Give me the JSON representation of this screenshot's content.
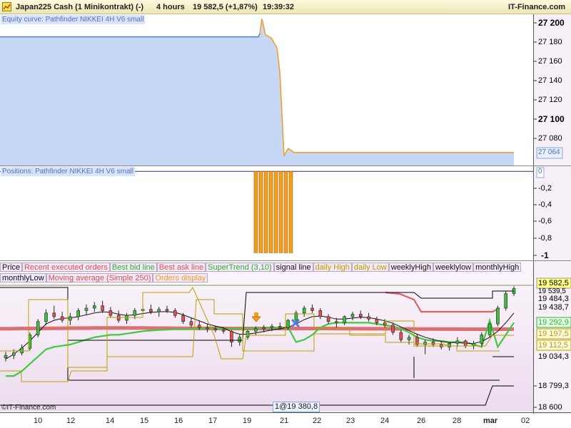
{
  "app": {
    "instrument": "Japan225 Cash (1 Minikontrakt) (-)",
    "timeframe": "4 hours",
    "last_price": "19 582,5 (+1,87%)",
    "time": "19:39:32",
    "brand": "IT-Finance.com",
    "copyright": "©IT-Finance.com"
  },
  "equity_pane": {
    "title": "Equity curve: Pathfinder NIKKEI 4H V6 small",
    "axis_labels": [
      "27 200",
      "27 180",
      "27 160",
      "27 140",
      "27 120",
      "27 100",
      "27 080"
    ],
    "current_label": "27 064",
    "chart_data": {
      "type": "area",
      "title": "Equity curve: Pathfinder NIKKEI 4H V6 small",
      "ylim": [
        27054,
        27205
      ],
      "y": [
        27183,
        27183,
        27183,
        27183,
        27183,
        27183,
        27183,
        27183,
        27183,
        27183,
        27183,
        27186,
        27201,
        27185,
        27182,
        27172,
        27148,
        27064,
        27071,
        27067,
        27067,
        27067,
        27067,
        27067,
        27067,
        27067,
        27067,
        27067,
        27067,
        27067,
        27067,
        27067,
        27067,
        27067,
        27067,
        27067,
        27067,
        27067,
        27067,
        27067
      ]
    }
  },
  "positions_pane": {
    "title": "Positions: Pathfinder NIKKEI 4H V6 small",
    "axis_labels": [
      "0",
      "-0,2",
      "-0,4",
      "-0,6",
      "-0,8",
      "-1"
    ],
    "chart_data": {
      "type": "bar",
      "title": "Positions: Pathfinder NIKKEI 4H V6 small",
      "ylim": [
        -1.05,
        0.02
      ],
      "values": [
        -1,
        -1,
        -1,
        -1,
        -1,
        -1,
        -1,
        -1
      ]
    }
  },
  "price_pane": {
    "legend_row1": [
      "Price",
      "Recent executed orders",
      "Best bid line",
      "Best ask line",
      "SuperTrend (3,10)",
      "signal line",
      "daily High",
      "daily Low",
      "weeklyHigh",
      "weeklylow",
      "monthlyHigh"
    ],
    "legend_row2": [
      "monthlyLow",
      "Moving average (Simple 250)",
      "Orders display"
    ],
    "legend_colors": [
      "#111111",
      "#e05050",
      "#30b030",
      "#e05050",
      "#30b030",
      "#111111",
      "#b8a000",
      "#b8a000",
      "#111111",
      "#111111",
      "#111111",
      "#111111",
      "#d85050",
      "#f0a020"
    ],
    "axis_labels": [
      "19 582,5",
      "19 539,5",
      "19 484,3",
      "19 438,7",
      "19 292,9",
      "19 197,5",
      "19 112,5",
      "19 034,3",
      "18 799,3",
      "18 600"
    ],
    "order_label": "1@19 380,8",
    "x_labels": [
      "10",
      "12",
      "14",
      "15",
      "16",
      "17",
      "19",
      "21",
      "22",
      "23",
      "24",
      "26",
      "28",
      "mar",
      "02"
    ],
    "chart_data": {
      "type": "candlestick",
      "ylim": [
        18590,
        19620
      ],
      "candles": [
        [
          19010,
          19060,
          18980,
          19030
        ],
        [
          19030,
          19080,
          19000,
          19050
        ],
        [
          19050,
          19120,
          19030,
          19090
        ],
        [
          19090,
          19220,
          19070,
          19200
        ],
        [
          19200,
          19330,
          19180,
          19310
        ],
        [
          19310,
          19410,
          19280,
          19380
        ],
        [
          19380,
          19440,
          19330,
          19350
        ],
        [
          19350,
          19390,
          19300,
          19320
        ],
        [
          19320,
          19380,
          19280,
          19350
        ],
        [
          19350,
          19420,
          19320,
          19400
        ],
        [
          19400,
          19450,
          19360,
          19420
        ],
        [
          19420,
          19470,
          19390,
          19440
        ],
        [
          19440,
          19480,
          19380,
          19400
        ],
        [
          19400,
          19430,
          19340,
          19360
        ],
        [
          19360,
          19400,
          19300,
          19320
        ],
        [
          19320,
          19380,
          19290,
          19360
        ],
        [
          19360,
          19420,
          19330,
          19400
        ],
        [
          19400,
          19440,
          19370,
          19410
        ],
        [
          19410,
          19450,
          19370,
          19390
        ],
        [
          19390,
          19430,
          19350,
          19410
        ],
        [
          19410,
          19440,
          19380,
          19400
        ],
        [
          19400,
          19420,
          19340,
          19360
        ],
        [
          19360,
          19380,
          19290,
          19310
        ],
        [
          19310,
          19340,
          19260,
          19280
        ],
        [
          19280,
          19320,
          19240,
          19260
        ],
        [
          19260,
          19290,
          19220,
          19250
        ],
        [
          19250,
          19270,
          19220,
          19240
        ],
        [
          19240,
          19260,
          19210,
          19230
        ],
        [
          19230,
          19240,
          19100,
          19140
        ],
        [
          19140,
          19200,
          19110,
          19180
        ],
        [
          19180,
          19240,
          19160,
          19230
        ],
        [
          19230,
          19270,
          19200,
          19250
        ],
        [
          19250,
          19280,
          19220,
          19260
        ],
        [
          19260,
          19290,
          19230,
          19270
        ],
        [
          19270,
          19300,
          19240,
          19260
        ],
        [
          19260,
          19330,
          19240,
          19320
        ],
        [
          19320,
          19400,
          19300,
          19380
        ],
        [
          19380,
          19440,
          19350,
          19420
        ],
        [
          19420,
          19450,
          19380,
          19400
        ],
        [
          19400,
          19420,
          19330,
          19350
        ],
        [
          19350,
          19370,
          19290,
          19310
        ],
        [
          19310,
          19340,
          19260,
          19300
        ],
        [
          19300,
          19360,
          19280,
          19350
        ],
        [
          19350,
          19390,
          19320,
          19370
        ],
        [
          19370,
          19400,
          19330,
          19350
        ],
        [
          19350,
          19380,
          19310,
          19330
        ],
        [
          19330,
          19350,
          19280,
          19300
        ],
        [
          19300,
          19330,
          19260,
          19280
        ],
        [
          19280,
          19300,
          19200,
          19220
        ],
        [
          19220,
          19240,
          19140,
          19160
        ],
        [
          19160,
          19200,
          19120,
          19180
        ],
        [
          19180,
          19210,
          19100,
          19120
        ],
        [
          19120,
          19160,
          19040,
          19140
        ],
        [
          19140,
          19170,
          19100,
          19120
        ],
        [
          19120,
          19150,
          19080,
          19100
        ],
        [
          19100,
          19140,
          19070,
          19130
        ],
        [
          19130,
          19180,
          19100,
          19150
        ],
        [
          19150,
          19160,
          19090,
          19110
        ],
        [
          19110,
          19150,
          19080,
          19130
        ],
        [
          19130,
          19220,
          19100,
          19200
        ],
        [
          19200,
          19300,
          19180,
          19290
        ],
        [
          19290,
          19440,
          19270,
          19420
        ],
        [
          19420,
          19560,
          19400,
          19540
        ],
        [
          19540,
          19600,
          19520,
          19582
        ]
      ],
      "supertrend": [
        18860,
        18860,
        18900,
        18960,
        19020,
        19080,
        19100,
        19110,
        19120,
        19140,
        19160,
        19180,
        19190,
        19200,
        19200,
        19210,
        19220,
        19230,
        19235,
        19240,
        19242,
        19245,
        19245,
        19248,
        19250,
        19250,
        19250,
        19250,
        19250,
        19250,
        19252,
        19254,
        19256,
        19258,
        19260,
        19262,
        19140,
        19160,
        19200,
        19260,
        19290,
        19300,
        19300,
        19300,
        19300,
        19300,
        19290,
        19280,
        19270,
        19250,
        19220,
        19180,
        19160,
        19150,
        19150,
        19140,
        19140,
        19140,
        19120,
        19100,
        19320,
        19100,
        19200,
        19300
      ],
      "signal_line": [
        19000,
        19040,
        19090,
        19150,
        19220,
        19290,
        19320,
        19335,
        19340,
        19350,
        19365,
        19380,
        19390,
        19385,
        19370,
        19360,
        19365,
        19375,
        19385,
        19390,
        19392,
        19385,
        19365,
        19340,
        19315,
        19290,
        19272,
        19258,
        19225,
        19205,
        19205,
        19215,
        19228,
        19240,
        19250,
        19262,
        19290,
        19325,
        19350,
        19355,
        19345,
        19330,
        19330,
        19338,
        19345,
        19342,
        19330,
        19315,
        19295,
        19265,
        19235,
        19205,
        19180,
        19162,
        19145,
        19136,
        19136,
        19130,
        19128,
        19145,
        19180,
        19230,
        19300,
        19380
      ],
      "moving_average": [
        19250,
        19251,
        19252,
        19252,
        19253,
        19253,
        19254,
        19254,
        19255,
        19255,
        19255,
        19256,
        19256,
        19256,
        19256,
        19256,
        19256,
        19256,
        19255,
        19255,
        19255,
        19254,
        19254,
        19254,
        19253,
        19253,
        19253,
        19252,
        19252,
        19252,
        19252,
        19252,
        19252,
        19252,
        19252,
        19252,
        19252,
        19252,
        19252,
        19252,
        19252,
        19252,
        19251,
        19251,
        19251,
        19250,
        19250,
        19250,
        19249,
        19249,
        19249,
        19248,
        19248,
        19248,
        19247,
        19247,
        19247,
        19246,
        19246,
        19246,
        19246,
        19246,
        19246,
        19246
      ]
    }
  }
}
